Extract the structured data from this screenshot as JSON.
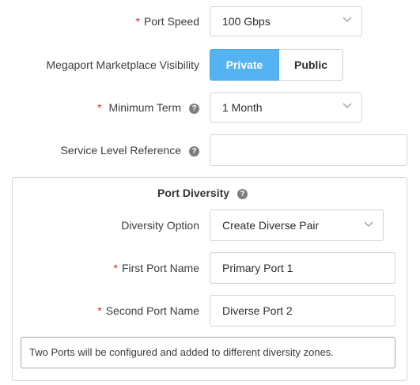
{
  "port_speed": {
    "label": "Port Speed",
    "value": "100 Gbps"
  },
  "visibility": {
    "label": "Megaport Marketplace Visibility",
    "options": [
      "Private",
      "Public"
    ],
    "selected": "Private"
  },
  "minimum_term": {
    "label": "Minimum Term",
    "value": "1 Month"
  },
  "service_level_reference": {
    "label": "Service Level Reference",
    "value": ""
  },
  "port_diversity": {
    "title": "Port Diversity",
    "diversity_option": {
      "label": "Diversity Option",
      "value": "Create Diverse Pair"
    },
    "first_port_name": {
      "label": "First Port Name",
      "value": "Primary Port 1"
    },
    "second_port_name": {
      "label": "Second Port Name",
      "value": "Diverse Port 2"
    },
    "note": "Two Ports will be configured and added to different diversity zones."
  },
  "colors": {
    "accent": "#56b3f2",
    "required": "#d6262d"
  },
  "icons": {
    "help": "question-circle-icon",
    "dropdown": "chevron-down-icon"
  }
}
